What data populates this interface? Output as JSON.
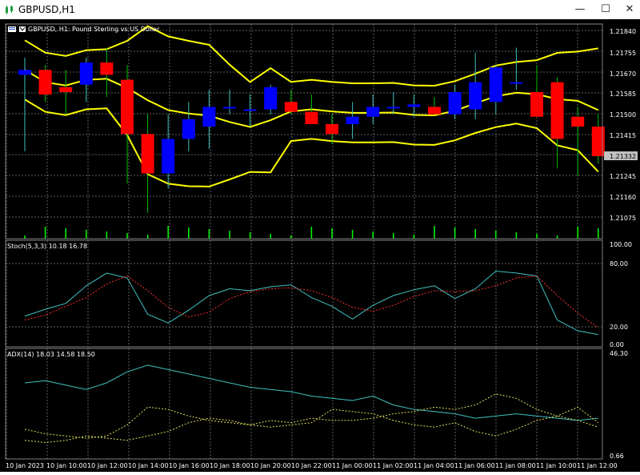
{
  "window": {
    "title": "GBPUSD,H1",
    "minimize": "—",
    "maximize": "☐",
    "close": "✕"
  },
  "main_chart": {
    "label": "GBPUSD, H1:  Pound Sterling vs US Dollar",
    "price_axis": [
      "1.21840",
      "1.21755",
      "1.21670",
      "1.21585",
      "1.21500",
      "1.21415",
      "1.21245",
      "1.21160",
      "1.21075"
    ],
    "current_price": "1.21332"
  },
  "stoch": {
    "label": "Stoch(5,3,3) 10.18 16.78",
    "axis": [
      "100.00",
      "80.00",
      "20.00",
      "0.00"
    ]
  },
  "adx": {
    "label": "ADX(14) 18.03 14.58 18.50",
    "axis": [
      "46.30",
      "0.66"
    ]
  },
  "time_axis": [
    "10 Jan 2023",
    "10 Jan 10:00",
    "10 Jan 12:00",
    "10 Jan 14:00",
    "10 Jan 16:00",
    "10 Jan 18:00",
    "10 Jan 20:00",
    "10 Jan 22:00",
    "11 Jan 00:00",
    "11 Jan 02:00",
    "11 Jan 04:00",
    "11 Jan 06:00",
    "11 Jan 08:00",
    "11 Jan 10:00",
    "11 Jan 12:00"
  ],
  "colors": {
    "background": "#000000",
    "grid": "#c0c0c0",
    "bull": "#0000ff",
    "bear": "#ff0000",
    "bands": "#ffff00",
    "stoch_main": "#40c0c0",
    "stoch_signal": "#ff3030",
    "adx_main": "#40c0c0",
    "adx_plus": "#e0e060",
    "adx_minus": "#e0e060",
    "volume": "#00ff00",
    "wick": "#00c000"
  },
  "chart_data": [
    {
      "type": "candlestick",
      "title": "GBPUSD, H1:  Pound Sterling vs US Dollar",
      "x": [
        "10 Jan 08:00",
        "10 Jan 09:00",
        "10 Jan 10:00",
        "10 Jan 11:00",
        "10 Jan 12:00",
        "10 Jan 13:00",
        "10 Jan 14:00",
        "10 Jan 15:00",
        "10 Jan 16:00",
        "10 Jan 17:00",
        "10 Jan 18:00",
        "10 Jan 19:00",
        "10 Jan 20:00",
        "10 Jan 21:00",
        "10 Jan 22:00",
        "10 Jan 23:00",
        "11 Jan 00:00",
        "11 Jan 01:00",
        "11 Jan 02:00",
        "11 Jan 03:00",
        "11 Jan 04:00",
        "11 Jan 05:00",
        "11 Jan 06:00",
        "11 Jan 07:00",
        "11 Jan 08:00",
        "11 Jan 09:00",
        "11 Jan 10:00",
        "11 Jan 11:00",
        "11 Jan 12:00"
      ],
      "open": [
        1.2166,
        1.2168,
        1.2161,
        1.2162,
        1.2171,
        1.2164,
        1.2142,
        1.2126,
        1.214,
        1.2145,
        1.2153,
        1.2152,
        1.2152,
        1.2155,
        1.2151,
        1.2146,
        1.2146,
        1.2149,
        1.2153,
        1.2153,
        1.2153,
        1.215,
        1.2152,
        1.2155,
        1.2163,
        1.2159,
        1.2163,
        1.2149,
        1.2145
      ],
      "high": [
        1.2173,
        1.217,
        1.2168,
        1.2173,
        1.2177,
        1.217,
        1.215,
        1.215,
        1.2155,
        1.216,
        1.216,
        1.2158,
        1.2162,
        1.216,
        1.2158,
        1.215,
        1.2155,
        1.2158,
        1.2159,
        1.2158,
        1.2157,
        1.2162,
        1.2175,
        1.217,
        1.2177,
        1.217,
        1.2165,
        1.2153,
        1.215
      ],
      "low": [
        1.2135,
        1.2155,
        1.215,
        1.2155,
        1.2157,
        1.2122,
        1.211,
        1.212,
        1.2135,
        1.2136,
        1.215,
        1.2145,
        1.215,
        1.215,
        1.2146,
        1.2138,
        1.214,
        1.2146,
        1.215,
        1.2149,
        1.215,
        1.2148,
        1.2148,
        1.215,
        1.216,
        1.2155,
        1.2128,
        1.2125,
        1.213
      ],
      "close": [
        1.2168,
        1.2158,
        1.2159,
        1.2171,
        1.2166,
        1.2142,
        1.2126,
        1.214,
        1.2148,
        1.2153,
        1.2153,
        1.2152,
        1.2161,
        1.2151,
        1.2146,
        1.2142,
        1.2149,
        1.2153,
        1.2153,
        1.2154,
        1.215,
        1.2159,
        1.2163,
        1.2169,
        1.2163,
        1.2149,
        1.214,
        1.2145,
        1.2133
      ],
      "ylim": [
        1.2107,
        1.2184
      ]
    },
    {
      "type": "line",
      "title": "Stoch(5,3,3) 10.18 16.78",
      "ylim": [
        0,
        100
      ],
      "series": [
        {
          "values": [
            29,
            36,
            42,
            60,
            73,
            68,
            31,
            22,
            35,
            50,
            57,
            55,
            59,
            61,
            48,
            39,
            26,
            40,
            50,
            56,
            60,
            47,
            57,
            75,
            73,
            70,
            25,
            14,
            10
          ]
        },
        {
          "values": [
            25,
            30,
            39,
            48,
            62,
            70,
            55,
            38,
            28,
            33,
            47,
            54,
            57,
            58,
            55,
            48,
            38,
            34,
            40,
            49,
            55,
            54,
            55,
            60,
            68,
            70,
            50,
            32,
            17
          ]
        }
      ]
    },
    {
      "type": "line",
      "title": "ADX(14) 18.03 14.58 18.50",
      "ylim": [
        0.66,
        46.3
      ],
      "series": [
        {
          "values": [
            34,
            35,
            33,
            31,
            34,
            39,
            42,
            40,
            38,
            36,
            34,
            32,
            31,
            30,
            28,
            27,
            26,
            28,
            24,
            22,
            21,
            20,
            18,
            19,
            20,
            19,
            18,
            17,
            18
          ]
        },
        {
          "values": [
            13,
            11,
            10,
            9,
            10,
            15,
            23,
            22,
            19,
            17,
            16,
            15,
            17,
            16,
            18,
            17,
            17,
            18,
            20,
            21,
            23,
            22,
            24,
            29,
            27,
            22,
            19,
            23,
            16
          ]
        },
        {
          "values": [
            8,
            7,
            8,
            10,
            9,
            8,
            10,
            12,
            16,
            18,
            17,
            15,
            14,
            15,
            16,
            22,
            21,
            20,
            17,
            15,
            14,
            16,
            12,
            10,
            13,
            17,
            19,
            17,
            14
          ]
        }
      ]
    }
  ]
}
